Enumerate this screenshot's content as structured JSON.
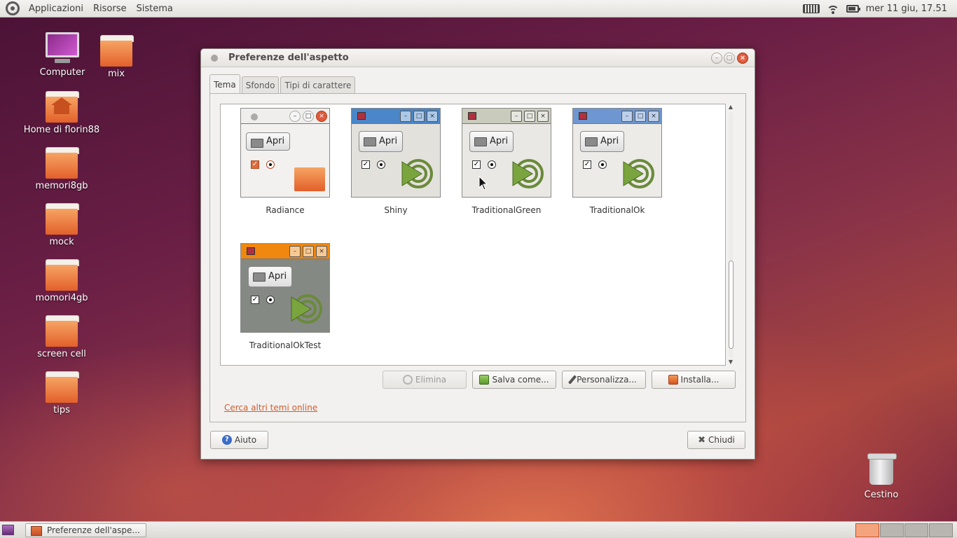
{
  "top_panel": {
    "menus": [
      "Applicazioni",
      "Risorse",
      "Sistema"
    ],
    "clock": "mer 11 giu, 17.51"
  },
  "desktop_icons": [
    {
      "label": "Computer",
      "icon": "computer-icon"
    },
    {
      "label": "mix",
      "icon": "folder-icon"
    },
    {
      "label": "Home di florin88",
      "icon": "home-folder-icon"
    },
    {
      "label": "memori8gb",
      "icon": "folder-icon"
    },
    {
      "label": "mock",
      "icon": "folder-icon"
    },
    {
      "label": "momori4gb",
      "icon": "folder-icon"
    },
    {
      "label": "screen cell",
      "icon": "folder-icon"
    },
    {
      "label": "tips",
      "icon": "folder-icon"
    },
    {
      "label": "Cestino",
      "icon": "trash-icon"
    }
  ],
  "window": {
    "title": "Preferenze dell'aspetto",
    "tabs": [
      "Tema",
      "Sfondo",
      "Tipi di carattere"
    ],
    "active_tab": "Tema",
    "themes": [
      {
        "name": "Radiance",
        "bar_color": "#efeeec",
        "body_color": "#f2f1f0",
        "button_label": "Apri"
      },
      {
        "name": "Shiny",
        "bar_color": "#4a86c8",
        "body_color": "#e3e1dc",
        "button_label": "Apri"
      },
      {
        "name": "TraditionalGreen",
        "bar_color": "#c9cbbc",
        "body_color": "#e9e8e4",
        "button_label": "Apri"
      },
      {
        "name": "TraditionalOk",
        "bar_color": "#6e97d2",
        "body_color": "#ecebe8",
        "button_label": "Apri"
      },
      {
        "name": "TraditionalOkTest",
        "bar_color": "#f0870e",
        "body_color": "#858983",
        "button_label": "Apri"
      }
    ],
    "buttons": {
      "elimina": "Elimina",
      "salva": "Salva come...",
      "personalizza": "Personalizza...",
      "installa": "Installa..."
    },
    "online_link": "Cerca altri temi online",
    "help": "Aiuto",
    "close": "Chiudi"
  },
  "bottom_panel": {
    "task_label": "Preferenze dell'aspe...",
    "workspaces": 4,
    "active_workspace": 1
  },
  "colors": {
    "accent": "#dd4814",
    "link": "#d25b2c"
  }
}
